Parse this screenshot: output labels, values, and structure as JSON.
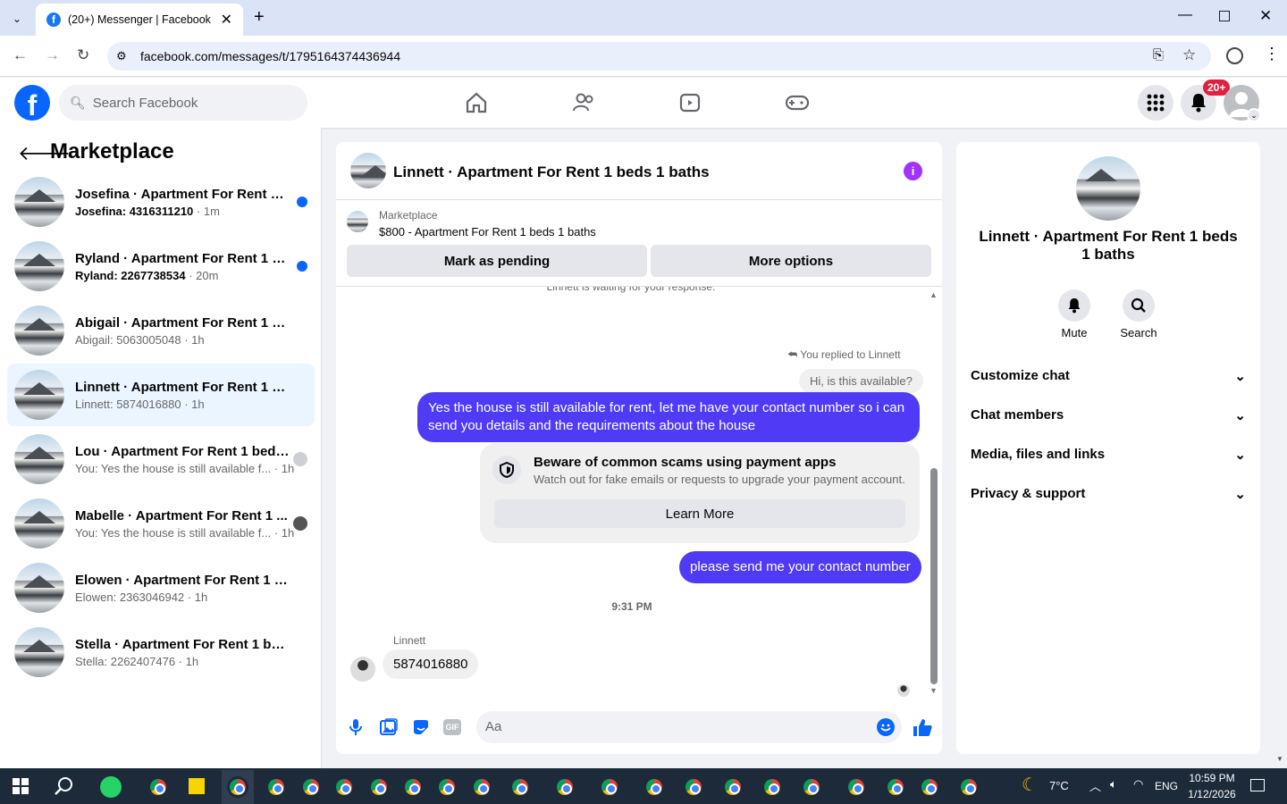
{
  "browser": {
    "tab_title": "(20+) Messenger | Facebook",
    "url": "facebook.com/messages/t/1795164374436944"
  },
  "fb": {
    "search_placeholder": "Search Facebook",
    "notif_badge": "20+"
  },
  "left": {
    "title": "Marketplace",
    "conversations": [
      {
        "name": "Josefina · Apartment For Rent 1 ...",
        "sender": "Josefina:",
        "snippet": "4316311210",
        "time": "· 1m",
        "unread": true
      },
      {
        "name": "Ryland · Apartment For Rent 1 b...",
        "sender": "Ryland:",
        "snippet": "2267738534",
        "time": "· 20m",
        "unread": true
      },
      {
        "name": "Abigail · Apartment For Rent 1 bed...",
        "sender": "",
        "snippet": "Abigail: 5063005048",
        "time": "· 1h",
        "unread": false
      },
      {
        "name": "Linnett · Apartment For Rent 1 bed...",
        "sender": "",
        "snippet": "Linnett: 5874016880",
        "time": "· 1h",
        "unread": false
      },
      {
        "name": "Lou · Apartment For Rent 1 beds...",
        "sender": "",
        "snippet": "You: Yes the house is still available f...",
        "time": "· 1h",
        "unread": false
      },
      {
        "name": "Mabelle · Apartment For Rent 1 ...",
        "sender": "",
        "snippet": "You: Yes the house is still available f...",
        "time": "· 1h",
        "unread": false
      },
      {
        "name": "Elowen · Apartment For Rent 1 bed...",
        "sender": "",
        "snippet": "Elowen: 2363046942",
        "time": "· 1h",
        "unread": false
      },
      {
        "name": "Stella · Apartment For Rent 1 beds ...",
        "sender": "",
        "snippet": "Stella: 2262407476",
        "time": "· 1h",
        "unread": false
      }
    ]
  },
  "chat": {
    "title": "Linnett · Apartment For Rent 1 beds 1 baths",
    "listing_source": "Marketplace",
    "listing_desc": "$800 - Apartment For Rent 1 beds 1 baths",
    "mark_pending": "Mark as pending",
    "more_options": "More options",
    "waiting_note": "Linnett is waiting for your response.",
    "replied_to": "You replied to Linnett",
    "quoted": "Hi, is this available?",
    "msg_out_1": "Yes the house is still available for rent, let me have your contact number so i can send you details and the requirements about the house",
    "scam_title": "Beware of common scams using payment apps",
    "scam_body": "Watch out for fake emails or requests to upgrade your payment account.",
    "learn_more": "Learn More",
    "msg_out_2": "please send me your contact number",
    "timestamp": "9:31 PM",
    "sender_name": "Linnett",
    "msg_in": "5874016880",
    "composer_placeholder": "Aa"
  },
  "info": {
    "title": "Linnett · Apartment For Rent 1 beds 1 baths",
    "mute": "Mute",
    "search": "Search",
    "sections": [
      "Customize chat",
      "Chat members",
      "Media, files and links",
      "Privacy & support"
    ]
  },
  "taskbar": {
    "weather": "7°C",
    "lang": "ENG",
    "time": "10:59 PM",
    "date": "1/12/2026"
  }
}
